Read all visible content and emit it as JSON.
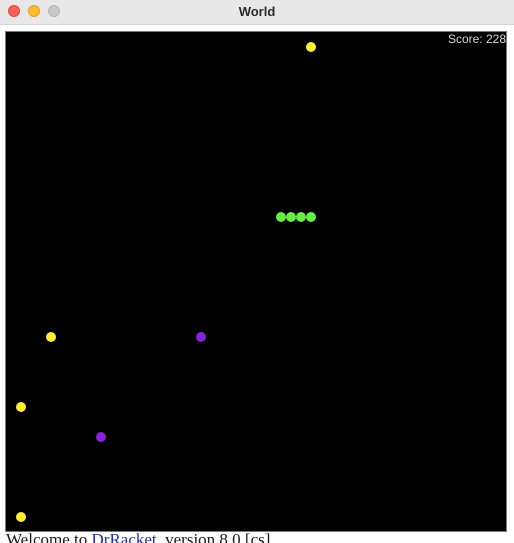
{
  "window": {
    "title": "World"
  },
  "game": {
    "score_text": "Score: 228",
    "background_color": "#000000",
    "snake_color": "#66ee44",
    "food_color": "#ffee33",
    "obstacle_color": "#8822dd",
    "snake_segments": [
      {
        "col": 27,
        "row": 18
      },
      {
        "col": 28,
        "row": 18
      },
      {
        "col": 29,
        "row": 18
      },
      {
        "col": 30,
        "row": 18
      }
    ],
    "food": [
      {
        "col": 30,
        "row": 1
      },
      {
        "col": 4,
        "row": 30
      },
      {
        "col": 1,
        "row": 37
      },
      {
        "col": 1,
        "row": 48
      }
    ],
    "obstacles": [
      {
        "col": 19,
        "row": 30
      },
      {
        "col": 9,
        "row": 40
      }
    ]
  },
  "repl": {
    "prefix": "Welcome to ",
    "link": "DrRacket",
    "suffix": ", version 8.0 [cs]."
  }
}
